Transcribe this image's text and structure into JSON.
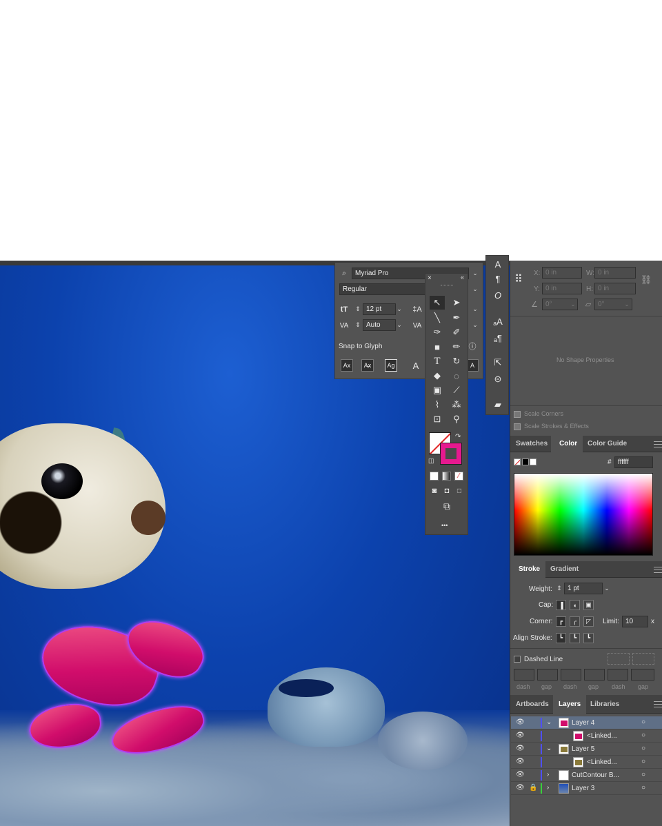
{
  "character": {
    "font_family": "Myriad Pro",
    "font_style": "Regular",
    "font_size": "12 pt",
    "leading": "Auto",
    "snap_to_glyph_label": "Snap to Glyph"
  },
  "transform": {
    "x_label": "X:",
    "x_value": "0 in",
    "y_label": "Y:",
    "y_value": "0 in",
    "w_label": "W:",
    "w_value": "0 in",
    "h_label": "H:",
    "h_value": "0 in",
    "angle_value": "0°",
    "shear_value": "0°",
    "no_shape": "No Shape Properties",
    "scale_corners": "Scale Corners",
    "scale_strokes": "Scale Strokes & Effects"
  },
  "color_panel": {
    "tabs": [
      "Swatches",
      "Color",
      "Color Guide"
    ],
    "active_tab": "Color",
    "hex_label": "#",
    "hex_value": "ffffff"
  },
  "stroke_panel": {
    "tabs": [
      "Stroke",
      "Gradient"
    ],
    "active_tab": "Stroke",
    "weight_label": "Weight:",
    "weight_value": "1 pt",
    "cap_label": "Cap:",
    "corner_label": "Corner:",
    "limit_label": "Limit:",
    "limit_value": "10",
    "limit_unit": "x",
    "align_label": "Align Stroke:",
    "dashed_label": "Dashed Line",
    "dash_labels": [
      "dash",
      "gap",
      "dash",
      "gap",
      "dash",
      "gap"
    ]
  },
  "layers_panel": {
    "tabs": [
      "Artboards",
      "Layers",
      "Libraries"
    ],
    "active_tab": "Layers",
    "rows": [
      {
        "name": "Layer 4",
        "color": "#4f4fff"
      },
      {
        "name": "<Linked...",
        "color": "#4f4fff"
      },
      {
        "name": "Layer 5",
        "color": "#4f4fff"
      },
      {
        "name": "<Linked...",
        "color": "#4f4fff"
      },
      {
        "name": "CutContour B...",
        "color": "#4f4fff"
      },
      {
        "name": "Layer 3",
        "color": "#37d13a"
      }
    ]
  },
  "toolbar": {
    "more_label": "•••"
  },
  "colors": {
    "panel_bg": "#535353",
    "fill_accent": "#e6198f"
  }
}
